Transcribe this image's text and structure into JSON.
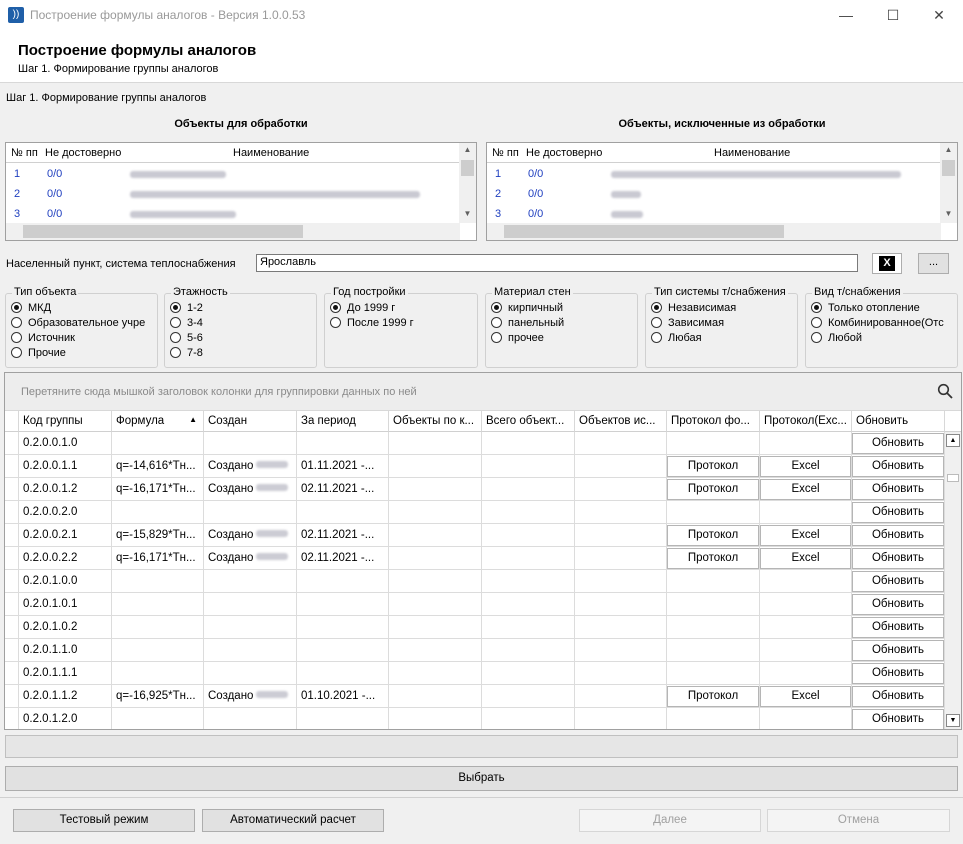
{
  "window": {
    "title": "Построение формулы аналогов - Версия 1.0.0.53",
    "icon": "app-logo-icon"
  },
  "header": {
    "title": "Построение формулы аналогов",
    "subtitle": "Шаг 1. Формирование группы аналогов"
  },
  "step_label": "Шаг 1. Формирование группы аналогов",
  "left_panel": {
    "title": "Объекты для обработки",
    "columns": [
      "№ пп",
      "Не достоверно",
      "Наименование"
    ],
    "rows": [
      {
        "num": "1",
        "unreliable": "0/0"
      },
      {
        "num": "2",
        "unreliable": "0/0"
      },
      {
        "num": "3",
        "unreliable": "0/0"
      }
    ]
  },
  "right_panel": {
    "title": "Объекты, исключенные из обработки",
    "columns": [
      "№ пп",
      "Не достоверно",
      "Наименование"
    ],
    "rows": [
      {
        "num": "1",
        "unreliable": "0/0"
      },
      {
        "num": "2",
        "unreliable": "0/0"
      },
      {
        "num": "3",
        "unreliable": "0/0"
      }
    ]
  },
  "location": {
    "label": "Населенный пункт, система теплоснабжения",
    "value": "Ярославль",
    "clear_label": "X",
    "more_label": "..."
  },
  "filters": [
    {
      "title": "Тип объекта",
      "options": [
        "МКД",
        "Образовательное учре",
        "Источник",
        "Прочие"
      ],
      "selected": 0
    },
    {
      "title": "Этажность",
      "options": [
        "1-2",
        "3-4",
        "5-6",
        "7-8"
      ],
      "selected": 0
    },
    {
      "title": "Год постройки",
      "options": [
        "До 1999 г",
        "После 1999 г"
      ],
      "selected": 0
    },
    {
      "title": "Материал стен",
      "options": [
        "кирпичный",
        "панельный",
        "прочее"
      ],
      "selected": 0
    },
    {
      "title": "Тип системы т/снабжения",
      "options": [
        "Независимая",
        "Зависимая",
        "Любая"
      ],
      "selected": 0
    },
    {
      "title": "Вид т/снабжения",
      "options": [
        "Только отопление",
        "Комбинированное(Отс",
        "Любой"
      ],
      "selected": 0
    }
  ],
  "main_grid": {
    "group_hint": "Перетяните сюда мышкой заголовок колонки для группировки данных по ней",
    "columns": [
      "Код группы",
      "Формула",
      "Создан",
      "За период",
      "Объекты по к...",
      "Всего объект...",
      "Объектов ис...",
      "Протокол фо...",
      "Протокол(Exc...",
      "Обновить"
    ],
    "sort_indicator": "▲",
    "rows": [
      {
        "code": "0.2.0.0.1.0",
        "formula": "",
        "created": "",
        "period": "",
        "protocol": "",
        "excel": "",
        "refresh": "Обновить"
      },
      {
        "code": "0.2.0.0.1.1",
        "formula": "q=-14,616*Тн...",
        "created": "Создано",
        "period": "01.11.2021 -...",
        "protocol": "Протокол",
        "excel": "Excel",
        "refresh": "Обновить"
      },
      {
        "code": "0.2.0.0.1.2",
        "formula": "q=-16,171*Тн...",
        "created": "Создано",
        "period": "02.11.2021 -...",
        "protocol": "Протокол",
        "excel": "Excel",
        "refresh": "Обновить"
      },
      {
        "code": "0.2.0.0.2.0",
        "formula": "",
        "created": "",
        "period": "",
        "protocol": "",
        "excel": "",
        "refresh": "Обновить"
      },
      {
        "code": "0.2.0.0.2.1",
        "formula": "q=-15,829*Тн...",
        "created": "Создано",
        "period": "02.11.2021 -...",
        "protocol": "Протокол",
        "excel": "Excel",
        "refresh": "Обновить"
      },
      {
        "code": "0.2.0.0.2.2",
        "formula": "q=-16,171*Тн...",
        "created": "Создано",
        "period": "02.11.2021 -...",
        "protocol": "Протокол",
        "excel": "Excel",
        "refresh": "Обновить"
      },
      {
        "code": "0.2.0.1.0.0",
        "formula": "",
        "created": "",
        "period": "",
        "protocol": "",
        "excel": "",
        "refresh": "Обновить"
      },
      {
        "code": "0.2.0.1.0.1",
        "formula": "",
        "created": "",
        "period": "",
        "protocol": "",
        "excel": "",
        "refresh": "Обновить"
      },
      {
        "code": "0.2.0.1.0.2",
        "formula": "",
        "created": "",
        "period": "",
        "protocol": "",
        "excel": "",
        "refresh": "Обновить"
      },
      {
        "code": "0.2.0.1.1.0",
        "formula": "",
        "created": "",
        "period": "",
        "protocol": "",
        "excel": "",
        "refresh": "Обновить"
      },
      {
        "code": "0.2.0.1.1.1",
        "formula": "",
        "created": "",
        "period": "",
        "protocol": "",
        "excel": "",
        "refresh": "Обновить"
      },
      {
        "code": "0.2.0.1.1.2",
        "formula": "q=-16,925*Тн...",
        "created": "Создано",
        "period": "01.10.2021 -...",
        "protocol": "Протокол",
        "excel": "Excel",
        "refresh": "Обновить"
      },
      {
        "code": "0.2.0.1.2.0",
        "formula": "",
        "created": "",
        "period": "",
        "protocol": "",
        "excel": "",
        "refresh": "Обновить"
      }
    ]
  },
  "select_label": "Выбрать",
  "footer": {
    "test_mode": "Тестовый режим",
    "auto_calc": "Автоматический расчет",
    "next": "Далее",
    "cancel": "Отмена"
  }
}
